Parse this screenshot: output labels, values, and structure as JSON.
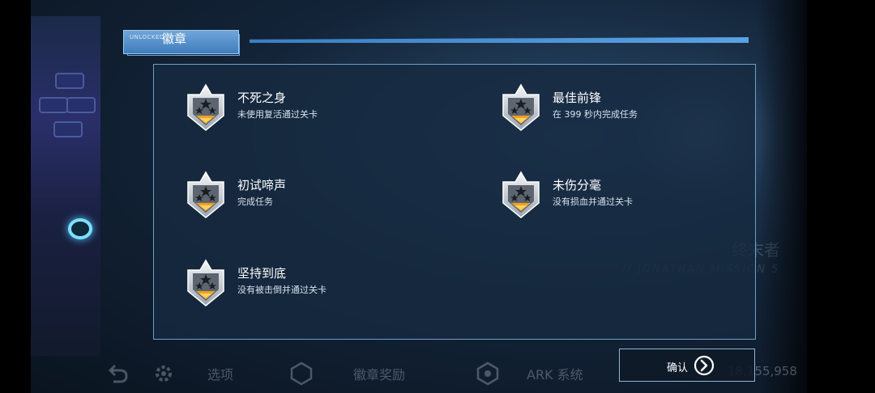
{
  "header": {
    "small_label": "UNLOCKED",
    "title": "徽章"
  },
  "achievements": [
    {
      "title": "不死之身",
      "description": "未使用复活通过关卡",
      "icon": "silver-star-badge-icon"
    },
    {
      "title": "最佳前锋",
      "description": "在 399 秒内完成任务",
      "icon": "silver-star-badge-icon"
    },
    {
      "title": "初试啼声",
      "description": "完成任务",
      "icon": "silver-star-badge-icon"
    },
    {
      "title": "未伤分毫",
      "description": "没有损血并通过关卡",
      "icon": "silver-star-badge-icon"
    },
    {
      "title": "坚持到底",
      "description": "没有被击倒并通过关卡",
      "icon": "silver-star-badge-icon"
    }
  ],
  "confirm": {
    "label": "确认",
    "icon": "arrow-right-circle-icon"
  },
  "background": {
    "character_name": "终末者",
    "character_sub": "// JONATHAN MISSION 5",
    "currency": "18,155,958"
  },
  "bottom_nav": {
    "options_label": "选项",
    "badge_reward_label": "徽章奖励",
    "ark_label": "ARK 系统"
  },
  "colors": {
    "accent": "#4f8fd0",
    "panel_border": "#6f9fc9",
    "badge_gold": "#f0a020"
  }
}
